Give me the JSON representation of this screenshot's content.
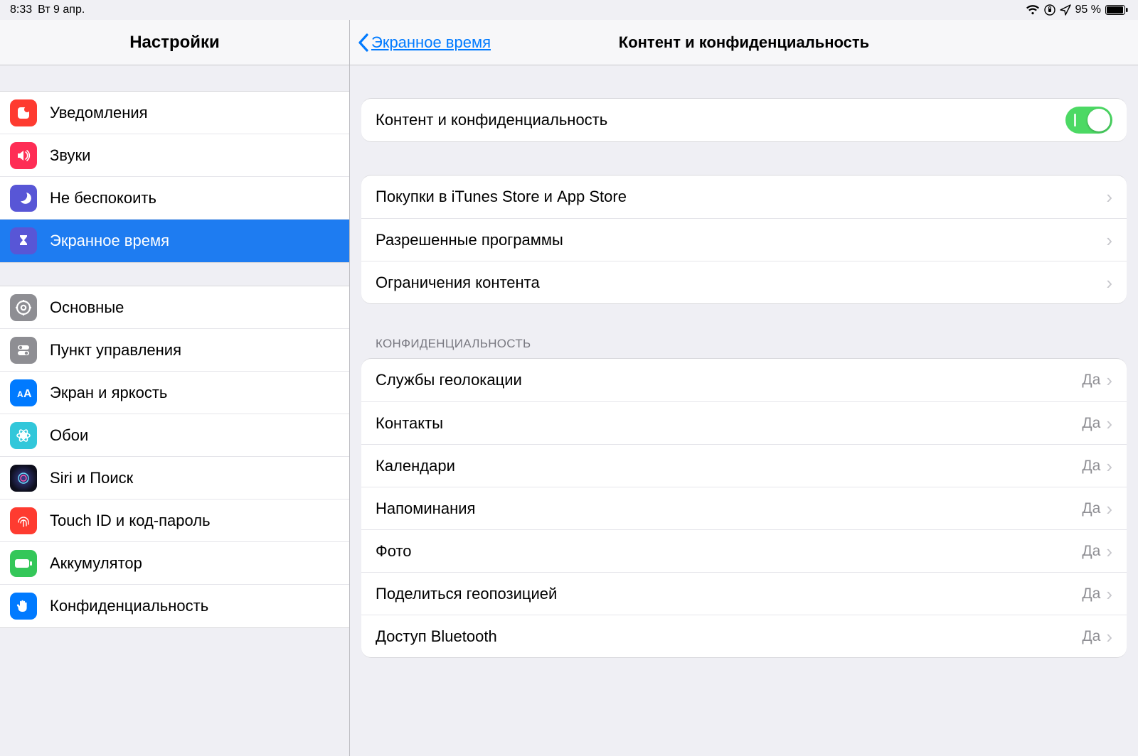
{
  "status": {
    "time": "8:33",
    "date": "Вт 9 апр.",
    "battery": "95 %"
  },
  "sidebar": {
    "title": "Настройки",
    "groups": [
      {
        "items": [
          {
            "id": "notifications",
            "label": "Уведомления"
          },
          {
            "id": "sounds",
            "label": "Звуки"
          },
          {
            "id": "dnd",
            "label": "Не беспокоить"
          },
          {
            "id": "screentime",
            "label": "Экранное время",
            "selected": true
          }
        ]
      },
      {
        "items": [
          {
            "id": "general",
            "label": "Основные"
          },
          {
            "id": "controlcenter",
            "label": "Пункт управления"
          },
          {
            "id": "display",
            "label": "Экран и яркость"
          },
          {
            "id": "wallpaper",
            "label": "Обои"
          },
          {
            "id": "siri",
            "label": "Siri и Поиск"
          },
          {
            "id": "touchid",
            "label": "Touch ID и код-пароль"
          },
          {
            "id": "battery",
            "label": "Аккумулятор"
          },
          {
            "id": "privacy",
            "label": "Конфиденциальность"
          }
        ]
      }
    ]
  },
  "detail": {
    "back_label": "Экранное время",
    "title": "Контент и конфиденциальность",
    "master_toggle": {
      "label": "Контент и конфиденциальность",
      "on": true
    },
    "group2": [
      {
        "label": "Покупки в iTunes Store и App Store"
      },
      {
        "label": "Разрешенные программы"
      },
      {
        "label": "Ограничения контента"
      }
    ],
    "privacy_header": "КОНФИДЕНЦИАЛЬНОСТЬ",
    "privacy_rows": [
      {
        "label": "Службы геолокации",
        "value": "Да"
      },
      {
        "label": "Контакты",
        "value": "Да"
      },
      {
        "label": "Календари",
        "value": "Да"
      },
      {
        "label": "Напоминания",
        "value": "Да"
      },
      {
        "label": "Фото",
        "value": "Да"
      },
      {
        "label": "Поделиться геопозицией",
        "value": "Да"
      },
      {
        "label": "Доступ Bluetooth",
        "value": "Да"
      }
    ]
  },
  "icons": {
    "notifications": {
      "bg": "#fe3b30"
    },
    "sounds": {
      "bg": "#fe2d55"
    },
    "dnd": {
      "bg": "#5856d6"
    },
    "screentime": {
      "bg": "#5856d6"
    },
    "general": {
      "bg": "#8e8e93"
    },
    "controlcenter": {
      "bg": "#8e8e93"
    },
    "display": {
      "bg": "#007aff"
    },
    "wallpaper": {
      "bg": "#32c7da"
    },
    "siri": {
      "bg": "#222"
    },
    "touchid": {
      "bg": "#fe3b30"
    },
    "battery": {
      "bg": "#34c759"
    },
    "privacy": {
      "bg": "#007aff"
    }
  }
}
